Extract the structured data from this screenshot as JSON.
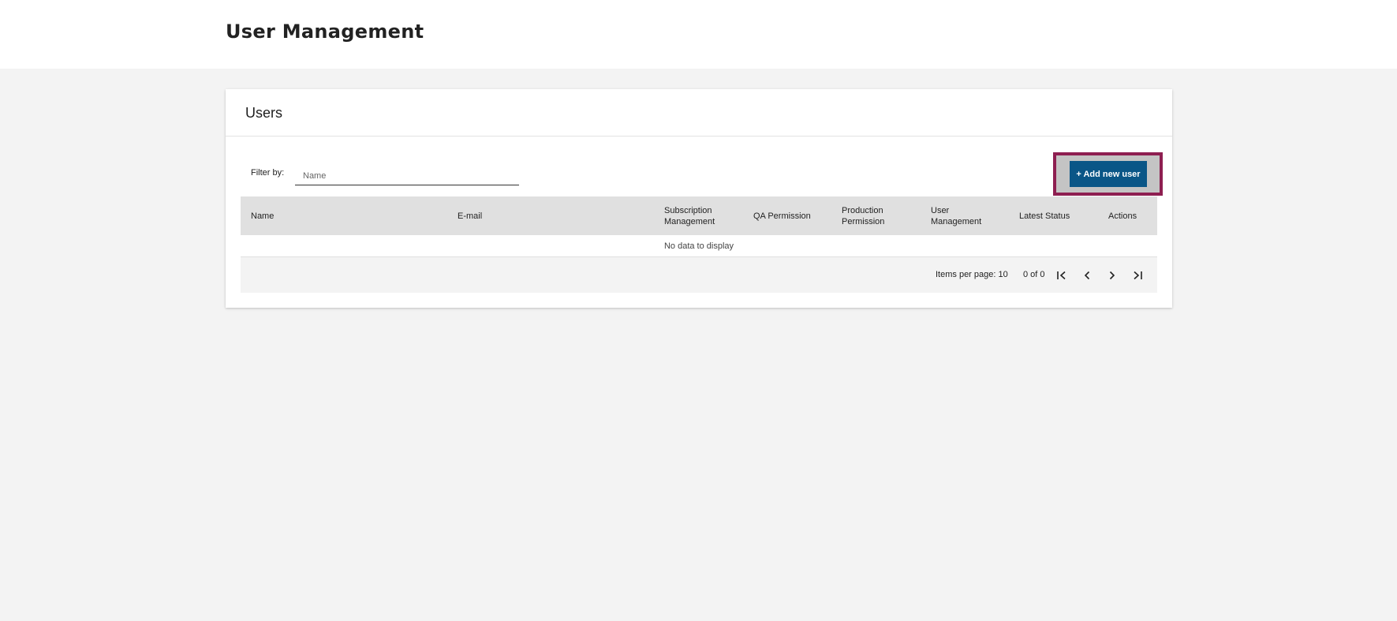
{
  "header": {
    "title": "User Management"
  },
  "card": {
    "title": "Users",
    "filter": {
      "label": "Filter by:",
      "placeholder": "Name",
      "value": ""
    },
    "add_button_label": "+ Add new user"
  },
  "table": {
    "columns": [
      "Name",
      "E-mail",
      "Subscription Management",
      "QA Permission",
      "Production Permission",
      "User Management",
      "Latest Status",
      "Actions"
    ],
    "empty_message": "No data to display"
  },
  "pagination": {
    "items_per_page_label": "Items per page:",
    "items_per_page": "10",
    "range": "0 of 0"
  },
  "colors": {
    "primary_button": "#0a5687",
    "highlight_border": "#8e1f51"
  },
  "icons": {
    "first": "first-page-icon",
    "prev": "chevron-left-icon",
    "next": "chevron-right-icon",
    "last": "last-page-icon"
  }
}
